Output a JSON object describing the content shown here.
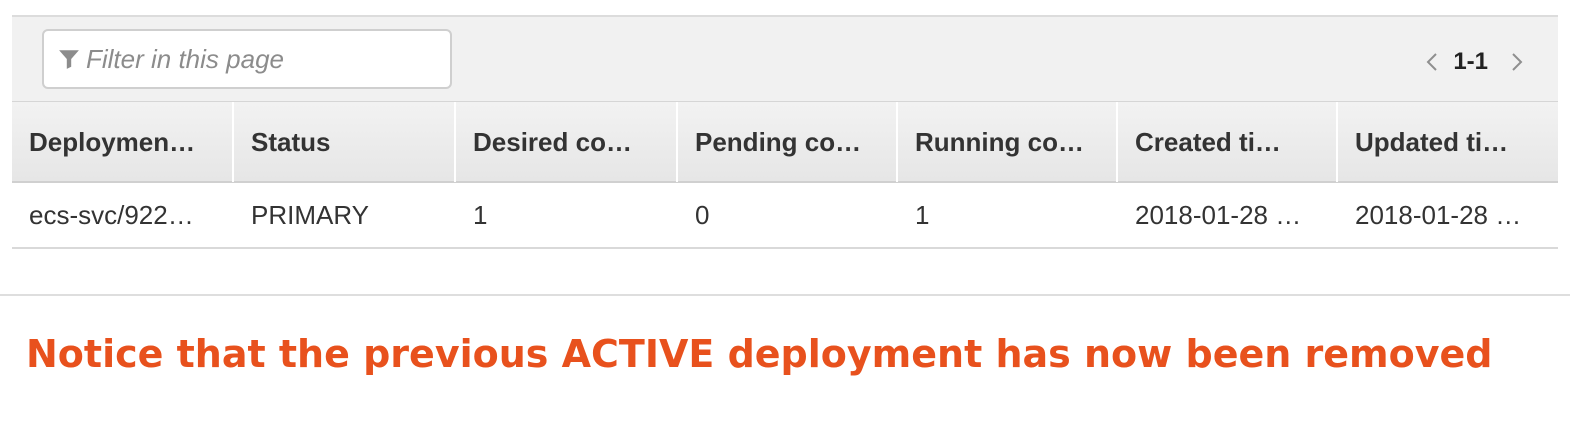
{
  "filter": {
    "placeholder": "Filter in this page"
  },
  "pagination": {
    "range": "1-1"
  },
  "table": {
    "headers": [
      "Deploymen…",
      "Status",
      "Desired co…",
      "Pending co…",
      "Running co…",
      "Created ti…",
      "Updated ti…"
    ],
    "rows": [
      [
        "ecs-svc/922…",
        "PRIMARY",
        "1",
        "0",
        "1",
        "2018-01-28 …",
        "2018-01-28 …"
      ]
    ]
  },
  "annotation": {
    "text": "Notice that the previous ACTIVE deployment has now been removed",
    "color": "#e8511d"
  },
  "icons": {
    "filter": "filter-funnel-icon",
    "prev": "chevron-left-icon",
    "next": "chevron-right-icon"
  }
}
